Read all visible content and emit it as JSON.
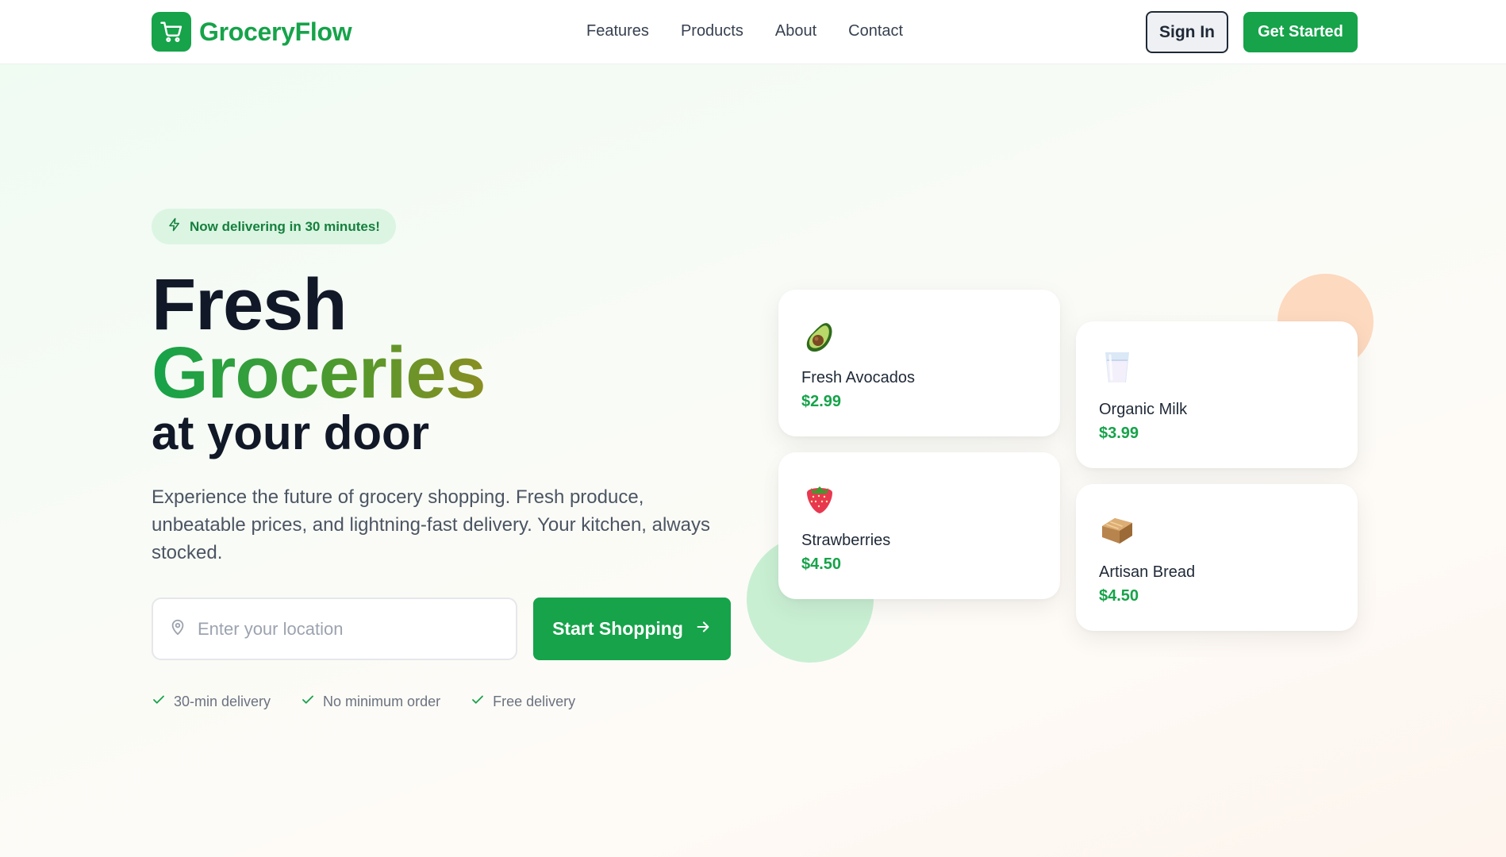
{
  "brand": {
    "name": "GroceryFlow",
    "accent": "#16a34a"
  },
  "nav": {
    "items": [
      "Features",
      "Products",
      "About",
      "Contact"
    ]
  },
  "header": {
    "sign_in": "Sign In",
    "get_started": "Get Started"
  },
  "hero": {
    "badge": "Now delivering in 30 minutes!",
    "title_line1": "Fresh",
    "title_line2": "Groceries",
    "title_line3": "at your door",
    "description": "Experience the future of grocery shopping. Fresh produce, unbeatable prices, and lightning-fast delivery. Your kitchen, always stocked.",
    "location_placeholder": "Enter your location",
    "cta": "Start Shopping",
    "perks": [
      "30-min delivery",
      "No minimum order",
      "Free delivery"
    ]
  },
  "products": [
    {
      "name": "Fresh Avocados",
      "price": "$2.99",
      "icon": "avocado-icon"
    },
    {
      "name": "Organic Milk",
      "price": "$3.99",
      "icon": "milk-glass-icon"
    },
    {
      "name": "Strawberries",
      "price": "$4.50",
      "icon": "strawberry-icon"
    },
    {
      "name": "Artisan Bread",
      "price": "$4.50",
      "icon": "bread-icon"
    }
  ]
}
